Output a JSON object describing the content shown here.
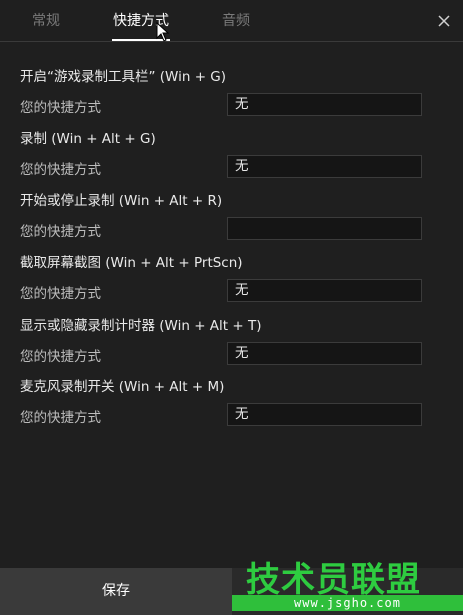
{
  "tabs": [
    {
      "label": "常规"
    },
    {
      "label": "快捷方式"
    },
    {
      "label": "音频"
    }
  ],
  "sections": [
    {
      "title": "开启“游戏录制工具栏” (Win + G)",
      "row_label": "您的快捷方式",
      "value": "无"
    },
    {
      "title": "录制 (Win + Alt + G)",
      "row_label": "您的快捷方式",
      "value": "无"
    },
    {
      "title": "开始或停止录制 (Win + Alt + R)",
      "row_label": "您的快捷方式",
      "value": ""
    },
    {
      "title": "截取屏幕截图 (Win + Alt + PrtScn)",
      "row_label": "您的快捷方式",
      "value": "无"
    },
    {
      "title": "显示或隐藏录制计时器 (Win + Alt + T)",
      "row_label": "您的快捷方式",
      "value": "无"
    },
    {
      "title": "麦克风录制开关 (Win + Alt + M)",
      "row_label": "您的快捷方式",
      "value": "无"
    }
  ],
  "footer": {
    "save_label": "保存",
    "watermark_title": "技术员联盟",
    "watermark_url": "www.jsgho.com"
  },
  "colors": {
    "background": "#1f1f1f",
    "accent_green": "#2ecc40"
  },
  "icons": {
    "close": "close-icon",
    "cursor": "mouse-cursor-icon"
  }
}
